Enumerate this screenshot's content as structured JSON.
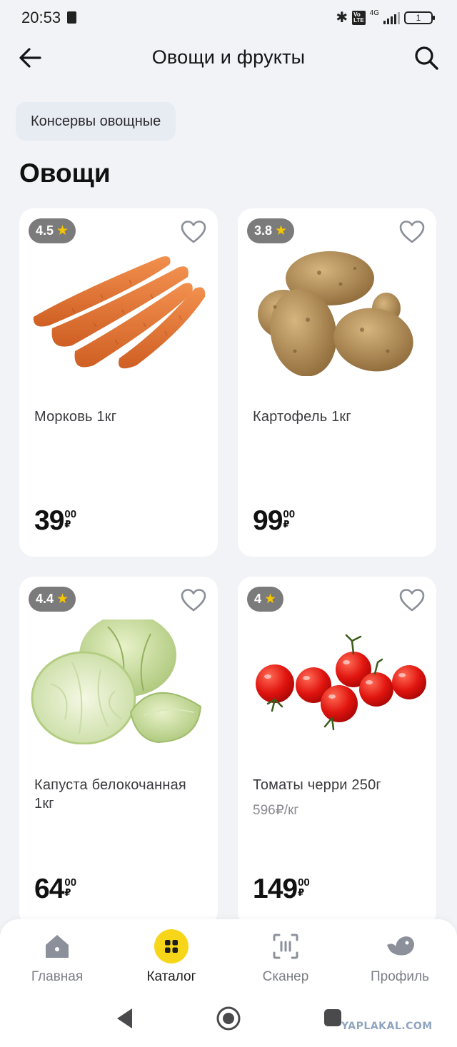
{
  "status_bar": {
    "time": "20:53",
    "network": "4G",
    "battery": "1"
  },
  "header": {
    "title": "Овощи и фрукты"
  },
  "chips": [
    {
      "label": "Консервы овощные"
    }
  ],
  "section": {
    "title": "Овощи"
  },
  "products": [
    {
      "name": "Морковь 1кг",
      "rating": "4.5",
      "price_int": "39",
      "price_cents": "00",
      "currency": "₽",
      "image": "carrots"
    },
    {
      "name": "Картофель 1кг",
      "rating": "3.8",
      "price_int": "99",
      "price_cents": "00",
      "currency": "₽",
      "image": "potatoes"
    },
    {
      "name": "Капуста белокочанная 1кг",
      "rating": "4.4",
      "price_int": "64",
      "price_cents": "00",
      "currency": "₽",
      "image": "cabbage"
    },
    {
      "name": "Томаты черри 250г",
      "unit_price": "596₽/кг",
      "rating": "4",
      "price_int": "149",
      "price_cents": "00",
      "currency": "₽",
      "image": "cherry-tomatoes"
    }
  ],
  "bottom_nav": {
    "active": "Каталог",
    "items": [
      {
        "label": "Главная",
        "icon": "home-icon"
      },
      {
        "label": "Каталог",
        "icon": "catalog-grid-icon"
      },
      {
        "label": "Сканер",
        "icon": "scanner-icon"
      },
      {
        "label": "Профиль",
        "icon": "bird-profile-icon"
      }
    ]
  },
  "watermark": "YAPLAKAL.COM",
  "colors": {
    "accent": "#f7d61a",
    "rating_bg": "#7b7b7b",
    "star": "#f7c600",
    "chip_bg": "#e7ebf2",
    "page_bg": "#f2f3f6"
  }
}
